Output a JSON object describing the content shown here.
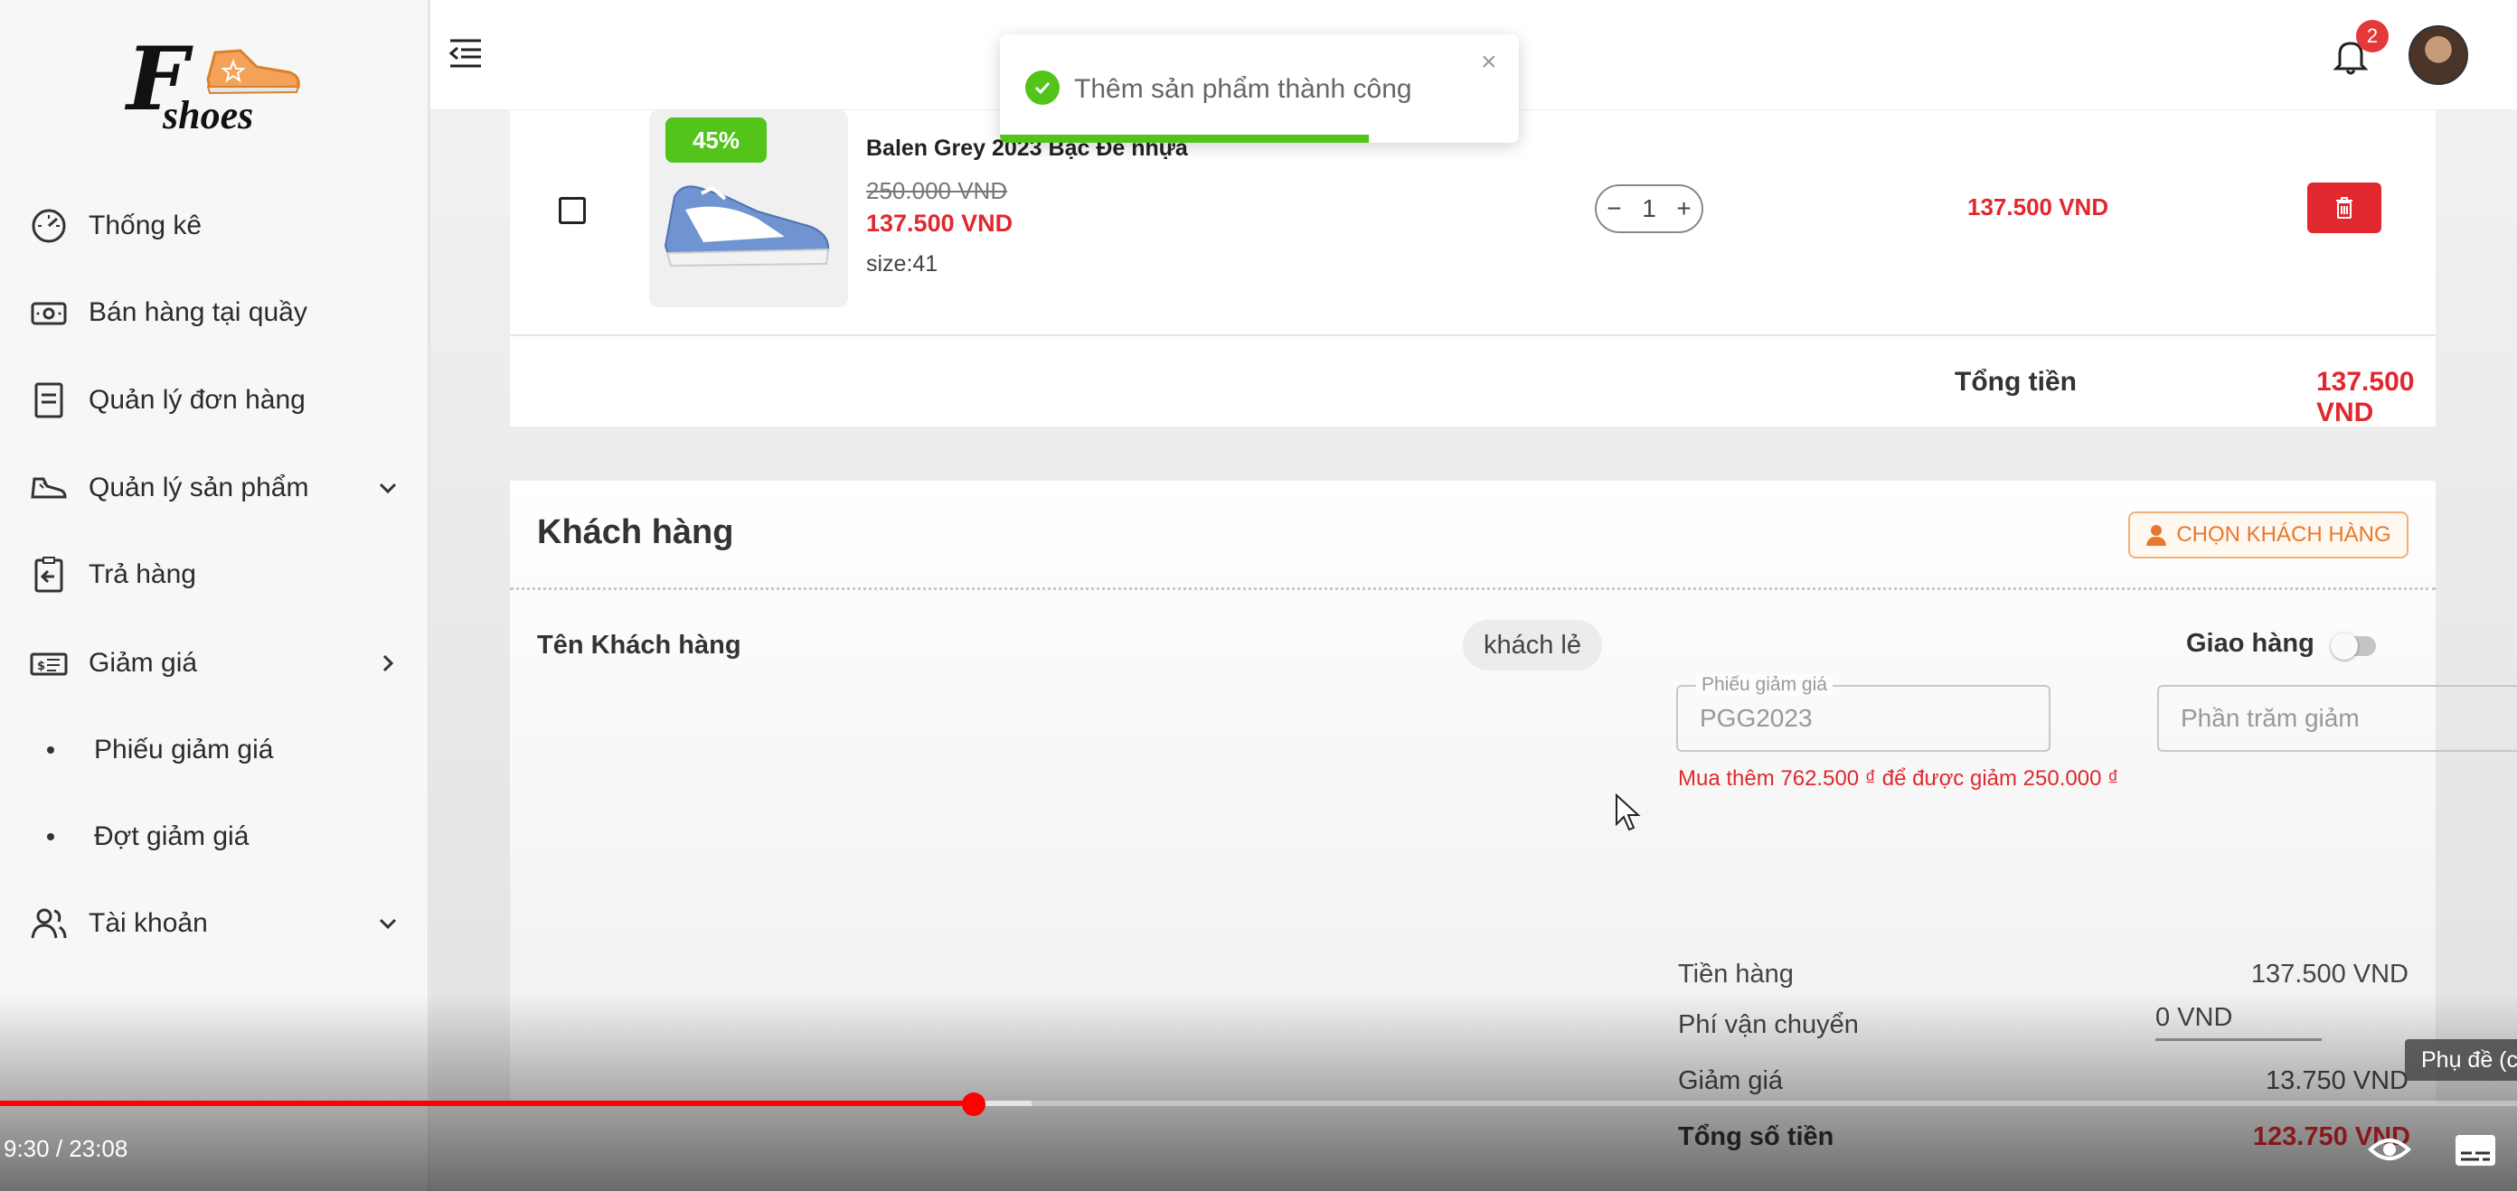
{
  "logo": {
    "letter": "F",
    "word": "shoes"
  },
  "sidebar": {
    "items": [
      {
        "label": "Thống kê",
        "icon": "dashboard-gauge-icon"
      },
      {
        "label": "Bán hàng tại quầy",
        "icon": "cash-icon"
      },
      {
        "label": "Quản lý đơn hàng",
        "icon": "document-icon"
      },
      {
        "label": "Quản lý sản phẩm",
        "icon": "shoe-icon",
        "chevron": "chevron-down-icon"
      },
      {
        "label": "Trả hàng",
        "icon": "return-icon"
      },
      {
        "label": "Giảm giá",
        "icon": "discount-ticket-icon",
        "chevron": "chevron-right-icon"
      },
      {
        "label": "Phiếu giảm giá"
      },
      {
        "label": "Đợt giảm giá"
      },
      {
        "label": "Tài khoản",
        "icon": "users-icon",
        "chevron": "chevron-down-icon"
      }
    ]
  },
  "header": {
    "notification_count": "2"
  },
  "toast": {
    "message": "Thêm sản phẩm thành công",
    "close": "×",
    "progress": 0.71
  },
  "cart": {
    "item": {
      "discount_badge": "45%",
      "name": "Balen Grey 2023 Bạc Đế nhựa",
      "original_price": "250.000 VND",
      "sale_price": "137.500 VND",
      "size": "size:41",
      "quantity": "1",
      "line_total": "137.500 VND",
      "qty_minus": "−",
      "qty_plus": "+"
    },
    "total_label": "Tổng tiền",
    "total_value": "137.500 VND"
  },
  "customer": {
    "title": "Khách hàng",
    "choose_button": "CHỌN KHÁCH HÀNG",
    "name_label": "Tên Khách hàng",
    "name_value": "khách lẻ",
    "shipping_label": "Giao hàng",
    "shipping_enabled": false,
    "voucher_label": "Phiếu giảm giá",
    "voucher_value": "PGG2023",
    "percent_placeholder": "Phần trăm giảm",
    "voucher_hint": "Mua thêm 762.500 ₫ để được giảm 250.000 ₫",
    "summary": {
      "subtotal_label": "Tiền hàng",
      "subtotal_value": "137.500 VND",
      "shipping_fee_label": "Phí vận chuyển",
      "shipping_fee_value": "0 VND",
      "discount_label": "Giảm giá",
      "discount_value": "13.750 VND",
      "grand_total_label": "Tổng số tiền",
      "grand_total_value": "123.750 VND"
    }
  },
  "video": {
    "timecode": "9:30 / 23:08",
    "played_fraction": 0.387,
    "buffered_fraction": 0.41,
    "cc_tooltip": "Phụ đề (c"
  },
  "colors": {
    "accent_red": "#e0282e",
    "success_green": "#52c41a",
    "orange": "#e8792c",
    "video_red": "#ff0000"
  }
}
